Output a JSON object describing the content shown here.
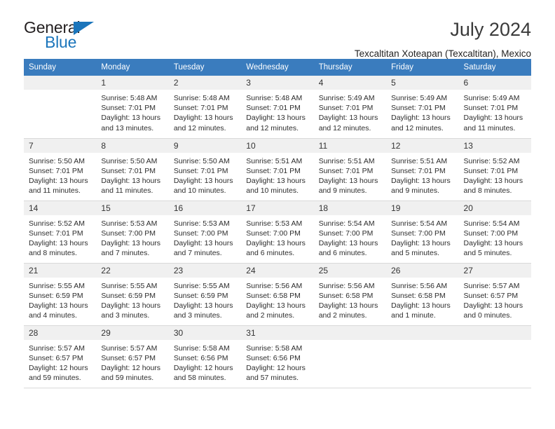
{
  "brand": {
    "name_part1": "General",
    "name_part2": "Blue",
    "triangle_color": "#1b75bb"
  },
  "header": {
    "title": "July 2024",
    "subtitle": "Texcaltitan Xoteapan (Texcaltitan), Mexico",
    "header_bg": "#3a7cbe",
    "daynum_bg": "#f0f0f0"
  },
  "weekday_headers": [
    "Sunday",
    "Monday",
    "Tuesday",
    "Wednesday",
    "Thursday",
    "Friday",
    "Saturday"
  ],
  "weeks": [
    [
      {
        "day": "",
        "lines": []
      },
      {
        "day": "1",
        "lines": [
          "Sunrise: 5:48 AM",
          "Sunset: 7:01 PM",
          "Daylight: 13 hours",
          "and 13 minutes."
        ]
      },
      {
        "day": "2",
        "lines": [
          "Sunrise: 5:48 AM",
          "Sunset: 7:01 PM",
          "Daylight: 13 hours",
          "and 12 minutes."
        ]
      },
      {
        "day": "3",
        "lines": [
          "Sunrise: 5:48 AM",
          "Sunset: 7:01 PM",
          "Daylight: 13 hours",
          "and 12 minutes."
        ]
      },
      {
        "day": "4",
        "lines": [
          "Sunrise: 5:49 AM",
          "Sunset: 7:01 PM",
          "Daylight: 13 hours",
          "and 12 minutes."
        ]
      },
      {
        "day": "5",
        "lines": [
          "Sunrise: 5:49 AM",
          "Sunset: 7:01 PM",
          "Daylight: 13 hours",
          "and 12 minutes."
        ]
      },
      {
        "day": "6",
        "lines": [
          "Sunrise: 5:49 AM",
          "Sunset: 7:01 PM",
          "Daylight: 13 hours",
          "and 11 minutes."
        ]
      }
    ],
    [
      {
        "day": "7",
        "lines": [
          "Sunrise: 5:50 AM",
          "Sunset: 7:01 PM",
          "Daylight: 13 hours",
          "and 11 minutes."
        ]
      },
      {
        "day": "8",
        "lines": [
          "Sunrise: 5:50 AM",
          "Sunset: 7:01 PM",
          "Daylight: 13 hours",
          "and 11 minutes."
        ]
      },
      {
        "day": "9",
        "lines": [
          "Sunrise: 5:50 AM",
          "Sunset: 7:01 PM",
          "Daylight: 13 hours",
          "and 10 minutes."
        ]
      },
      {
        "day": "10",
        "lines": [
          "Sunrise: 5:51 AM",
          "Sunset: 7:01 PM",
          "Daylight: 13 hours",
          "and 10 minutes."
        ]
      },
      {
        "day": "11",
        "lines": [
          "Sunrise: 5:51 AM",
          "Sunset: 7:01 PM",
          "Daylight: 13 hours",
          "and 9 minutes."
        ]
      },
      {
        "day": "12",
        "lines": [
          "Sunrise: 5:51 AM",
          "Sunset: 7:01 PM",
          "Daylight: 13 hours",
          "and 9 minutes."
        ]
      },
      {
        "day": "13",
        "lines": [
          "Sunrise: 5:52 AM",
          "Sunset: 7:01 PM",
          "Daylight: 13 hours",
          "and 8 minutes."
        ]
      }
    ],
    [
      {
        "day": "14",
        "lines": [
          "Sunrise: 5:52 AM",
          "Sunset: 7:01 PM",
          "Daylight: 13 hours",
          "and 8 minutes."
        ]
      },
      {
        "day": "15",
        "lines": [
          "Sunrise: 5:53 AM",
          "Sunset: 7:00 PM",
          "Daylight: 13 hours",
          "and 7 minutes."
        ]
      },
      {
        "day": "16",
        "lines": [
          "Sunrise: 5:53 AM",
          "Sunset: 7:00 PM",
          "Daylight: 13 hours",
          "and 7 minutes."
        ]
      },
      {
        "day": "17",
        "lines": [
          "Sunrise: 5:53 AM",
          "Sunset: 7:00 PM",
          "Daylight: 13 hours",
          "and 6 minutes."
        ]
      },
      {
        "day": "18",
        "lines": [
          "Sunrise: 5:54 AM",
          "Sunset: 7:00 PM",
          "Daylight: 13 hours",
          "and 6 minutes."
        ]
      },
      {
        "day": "19",
        "lines": [
          "Sunrise: 5:54 AM",
          "Sunset: 7:00 PM",
          "Daylight: 13 hours",
          "and 5 minutes."
        ]
      },
      {
        "day": "20",
        "lines": [
          "Sunrise: 5:54 AM",
          "Sunset: 7:00 PM",
          "Daylight: 13 hours",
          "and 5 minutes."
        ]
      }
    ],
    [
      {
        "day": "21",
        "lines": [
          "Sunrise: 5:55 AM",
          "Sunset: 6:59 PM",
          "Daylight: 13 hours",
          "and 4 minutes."
        ]
      },
      {
        "day": "22",
        "lines": [
          "Sunrise: 5:55 AM",
          "Sunset: 6:59 PM",
          "Daylight: 13 hours",
          "and 3 minutes."
        ]
      },
      {
        "day": "23",
        "lines": [
          "Sunrise: 5:55 AM",
          "Sunset: 6:59 PM",
          "Daylight: 13 hours",
          "and 3 minutes."
        ]
      },
      {
        "day": "24",
        "lines": [
          "Sunrise: 5:56 AM",
          "Sunset: 6:58 PM",
          "Daylight: 13 hours",
          "and 2 minutes."
        ]
      },
      {
        "day": "25",
        "lines": [
          "Sunrise: 5:56 AM",
          "Sunset: 6:58 PM",
          "Daylight: 13 hours",
          "and 2 minutes."
        ]
      },
      {
        "day": "26",
        "lines": [
          "Sunrise: 5:56 AM",
          "Sunset: 6:58 PM",
          "Daylight: 13 hours",
          "and 1 minute."
        ]
      },
      {
        "day": "27",
        "lines": [
          "Sunrise: 5:57 AM",
          "Sunset: 6:57 PM",
          "Daylight: 13 hours",
          "and 0 minutes."
        ]
      }
    ],
    [
      {
        "day": "28",
        "lines": [
          "Sunrise: 5:57 AM",
          "Sunset: 6:57 PM",
          "Daylight: 12 hours",
          "and 59 minutes."
        ]
      },
      {
        "day": "29",
        "lines": [
          "Sunrise: 5:57 AM",
          "Sunset: 6:57 PM",
          "Daylight: 12 hours",
          "and 59 minutes."
        ]
      },
      {
        "day": "30",
        "lines": [
          "Sunrise: 5:58 AM",
          "Sunset: 6:56 PM",
          "Daylight: 12 hours",
          "and 58 minutes."
        ]
      },
      {
        "day": "31",
        "lines": [
          "Sunrise: 5:58 AM",
          "Sunset: 6:56 PM",
          "Daylight: 12 hours",
          "and 57 minutes."
        ]
      },
      {
        "day": "",
        "lines": []
      },
      {
        "day": "",
        "lines": []
      },
      {
        "day": "",
        "lines": []
      }
    ]
  ]
}
